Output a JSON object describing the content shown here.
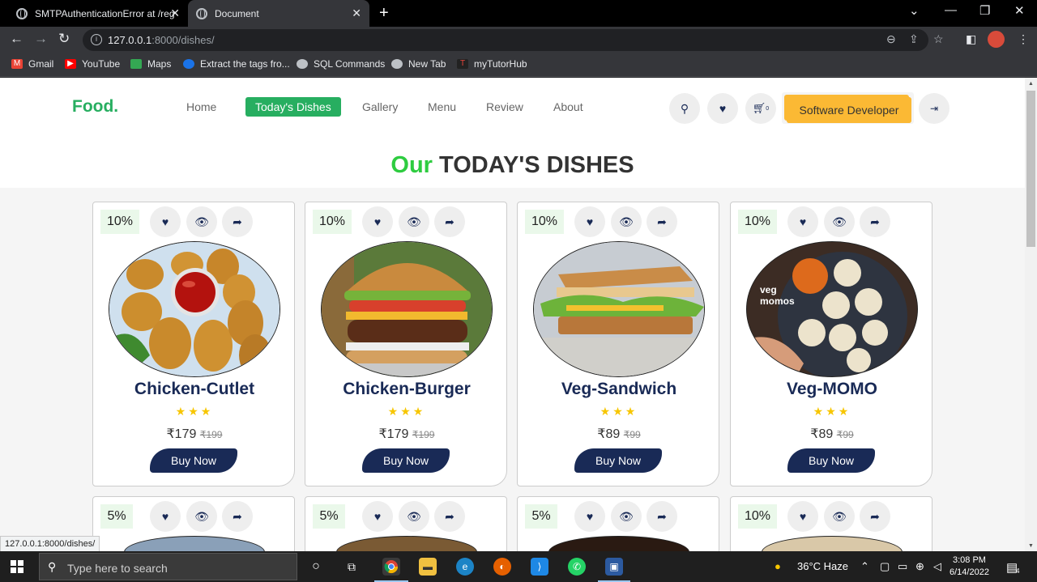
{
  "browser": {
    "tabs": [
      {
        "title": "SMTPAuthenticationError at /reg"
      },
      {
        "title": "Document"
      }
    ],
    "url_host": "127.0.0.1",
    "url_path": ":8000/dishes/",
    "bookmarks": [
      "Gmail",
      "YouTube",
      "Maps",
      "Extract the tags fro...",
      "SQL Commands",
      "New Tab",
      "myTutorHub"
    ],
    "status_url": "127.0.0.1:8000/dishes/"
  },
  "site": {
    "logo": "Food.",
    "nav": [
      "Home",
      "Today's Dishes",
      "Gallery",
      "Menu",
      "Review",
      "About"
    ],
    "active_nav": "Today's Dishes",
    "cart_count": "0",
    "profile": "Software Developer",
    "heading_accent": "Our",
    "heading": "TODAY'S DISHES"
  },
  "dishes": [
    {
      "discount": "10%",
      "name": "Chicken-Cutlet",
      "stars": "★★★",
      "price": "₹179",
      "old_price": "₹199",
      "buy": "Buy Now"
    },
    {
      "discount": "10%",
      "name": "Chicken-Burger",
      "stars": "★★★",
      "price": "₹179",
      "old_price": "₹199",
      "buy": "Buy Now"
    },
    {
      "discount": "10%",
      "name": "Veg-Sandwich",
      "stars": "★★★",
      "price": "₹89",
      "old_price": "₹99",
      "buy": "Buy Now"
    },
    {
      "discount": "10%",
      "name": "Veg-MOMO",
      "stars": "★★★",
      "price": "₹89",
      "old_price": "₹99",
      "buy": "Buy Now"
    }
  ],
  "dishes_row2": [
    {
      "discount": "5%"
    },
    {
      "discount": "5%"
    },
    {
      "discount": "5%"
    },
    {
      "discount": "10%"
    }
  ],
  "momo_overlay": "veg\nmomos",
  "taskbar": {
    "search_placeholder": "Type here to search",
    "weather": "36°C  Haze",
    "time": "3:08 PM",
    "date": "6/14/2022",
    "notif_count": "4"
  },
  "colors": {
    "brand": "#27ae60",
    "dark": "#192a56",
    "profile": "#fbb934"
  }
}
